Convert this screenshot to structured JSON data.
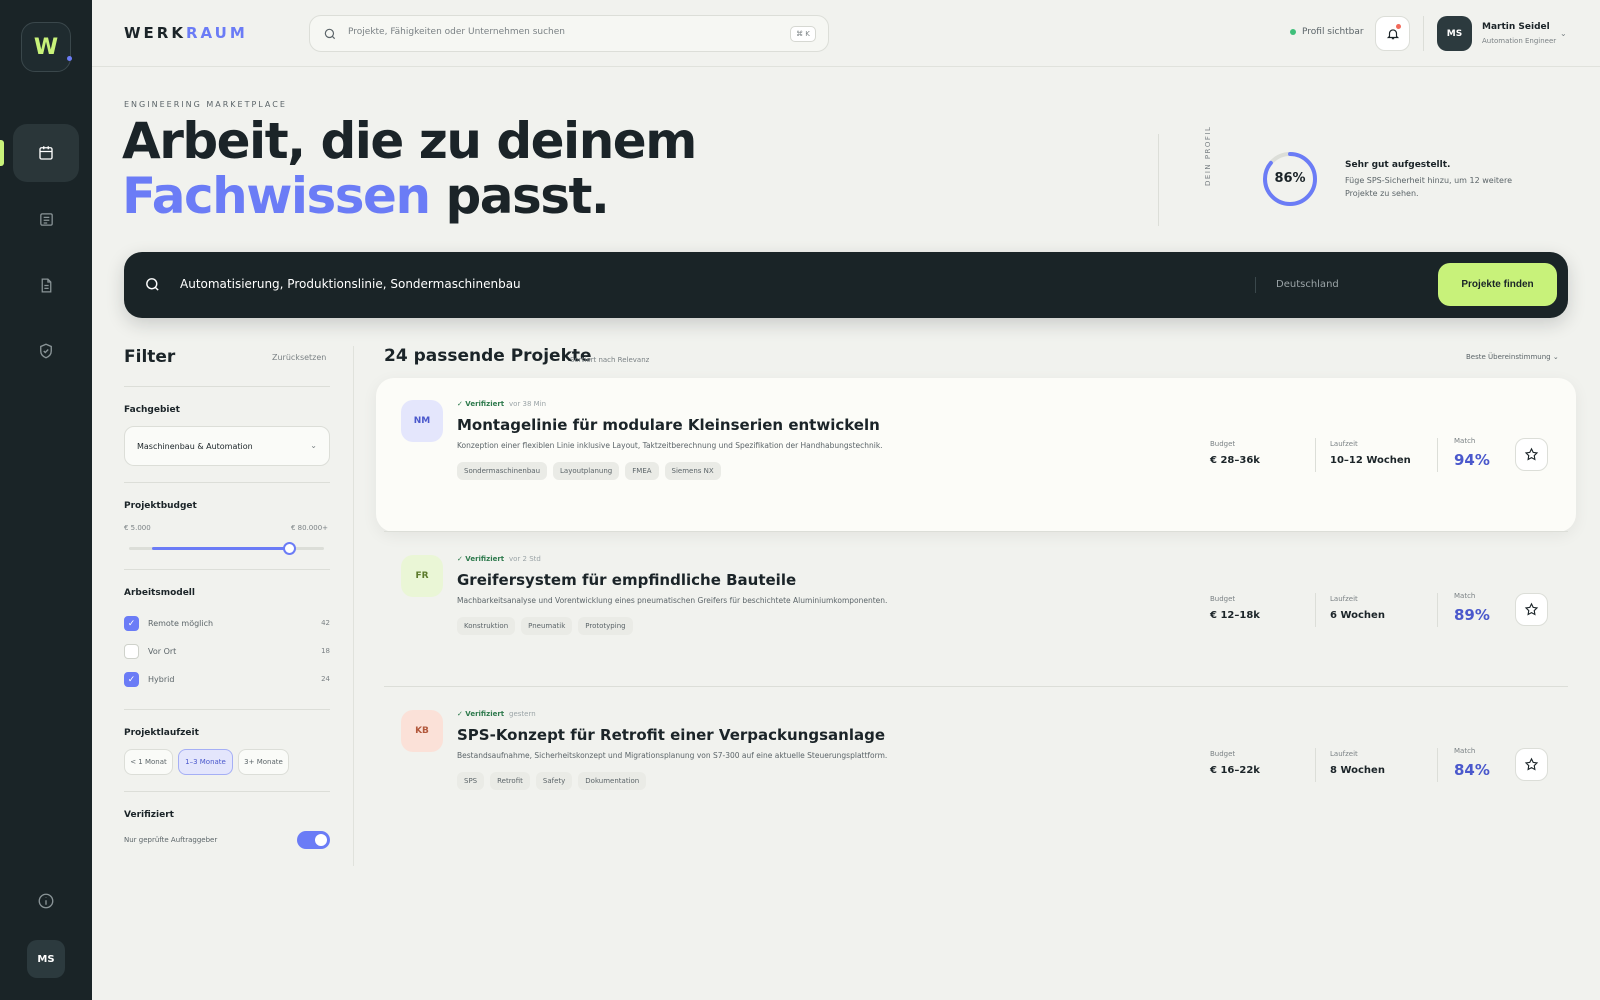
{
  "sidebar": {
    "logo": "W",
    "avatar": "MS",
    "nav": [
      {
        "icon": "calendar-icon",
        "active": true
      },
      {
        "icon": "document-icon",
        "active": false
      },
      {
        "icon": "file-icon",
        "active": false
      },
      {
        "icon": "shield-icon",
        "active": false
      }
    ]
  },
  "topbar": {
    "brand_prefix": "WERK",
    "brand_suffix": "RAUM",
    "search_placeholder": "Projekte, Fähigkeiten oder Unternehmen suchen",
    "shortcut": "⌘ K",
    "visibility": "Profil sichtbar",
    "user": {
      "initials": "MS",
      "name": "Martin Seidel",
      "role": "Automation Engineer"
    }
  },
  "hero": {
    "eyebrow": "ENGINEERING MARKETPLACE",
    "title_line1": "Arbeit, die zu deinem",
    "title_accent": "Fachwissen",
    "title_rest": " passt.",
    "profile_label": "DEIN PROFIL",
    "profile_percent": "86%",
    "profile_value": 0.86,
    "profile_head": "Sehr gut aufgestellt.",
    "profile_desc": "Füge SPS-Sicherheit hinzu, um 12 weitere Projekte zu sehen."
  },
  "bigsearch": {
    "query": "Automatisierung, Produktionslinie, Sondermaschinenbau",
    "location": "Deutschland",
    "button": "Projekte finden"
  },
  "filter": {
    "title": "Filter",
    "reset": "Zurücksetzen",
    "fachgebiet_label": "Fachgebiet",
    "fachgebiet_value": "Maschinenbau & Automation",
    "budget_label": "Projektbudget",
    "budget_min": "€ 5.000",
    "budget_max": "€ 80.000+",
    "budget_low": 0.12,
    "budget_high": 0.82,
    "arbeitsmodell_label": "Arbeitsmodell",
    "arbeitsmodell": [
      {
        "label": "Remote möglich",
        "count": "42",
        "checked": true
      },
      {
        "label": "Vor Ort",
        "count": "18",
        "checked": false
      },
      {
        "label": "Hybrid",
        "count": "24",
        "checked": true
      }
    ],
    "laufzeit_label": "Projektlaufzeit",
    "laufzeit": [
      {
        "label": "< 1 Monat",
        "active": false
      },
      {
        "label": "1–3 Monate",
        "active": true
      },
      {
        "label": "3+ Monate",
        "active": false
      }
    ],
    "verified_label": "Verifiziert",
    "verified_sub": "Nur geprüfte Auftraggeber",
    "verified_on": true
  },
  "results": {
    "title": "24 passende Projekte",
    "sub": "Sortiert nach Relevanz",
    "sort": "Beste Übereinstimmung ⌄",
    "labels": {
      "budget": "Budget",
      "duration": "Laufzeit",
      "match": "Match",
      "verified": "✓ Verifiziert"
    },
    "projects": [
      {
        "initials": "NM",
        "logo_bg": "#e4e6fc",
        "logo_fg": "#4a58cc",
        "time": "vor 38 Min",
        "title": "Montagelinie für modulare Kleinserien entwickeln",
        "desc": "Konzeption einer flexiblen Linie inklusive Layout, Taktzeitberechnung und Spezifikation der Handhabungstechnik.",
        "tags": [
          "Sondermaschinenbau",
          "Layoutplanung",
          "FMEA",
          "Siemens NX"
        ],
        "budget": "€ 28–36k",
        "duration": "10–12 Wochen",
        "match": "94%"
      },
      {
        "initials": "FR",
        "logo_bg": "#eaf6d6",
        "logo_fg": "#5c7a2c",
        "time": "vor 2 Std",
        "title": "Greifersystem für empfindliche Bauteile",
        "desc": "Machbarkeitsanalyse und Vorentwicklung eines pneumatischen Greifers für beschichtete Aluminiumkomponenten.",
        "tags": [
          "Konstruktion",
          "Pneumatik",
          "Prototyping"
        ],
        "budget": "€ 12–18k",
        "duration": "6 Wochen",
        "match": "89%"
      },
      {
        "initials": "KB",
        "logo_bg": "#fbe1d8",
        "logo_fg": "#b2583c",
        "time": "gestern",
        "title": "SPS-Konzept für Retrofit einer Verpackungsanlage",
        "desc": "Bestandsaufnahme, Sicherheitskonzept und Migrationsplanung von S7-300 auf eine aktuelle Steuerungsplattform.",
        "tags": [
          "SPS",
          "Retrofit",
          "Safety",
          "Dokumentation"
        ],
        "budget": "€ 16–22k",
        "duration": "8 Wochen",
        "match": "84%"
      }
    ]
  },
  "colors": {
    "accent": "#6b7cf6",
    "lime": "#c8f27a",
    "dark": "#1a2427"
  }
}
